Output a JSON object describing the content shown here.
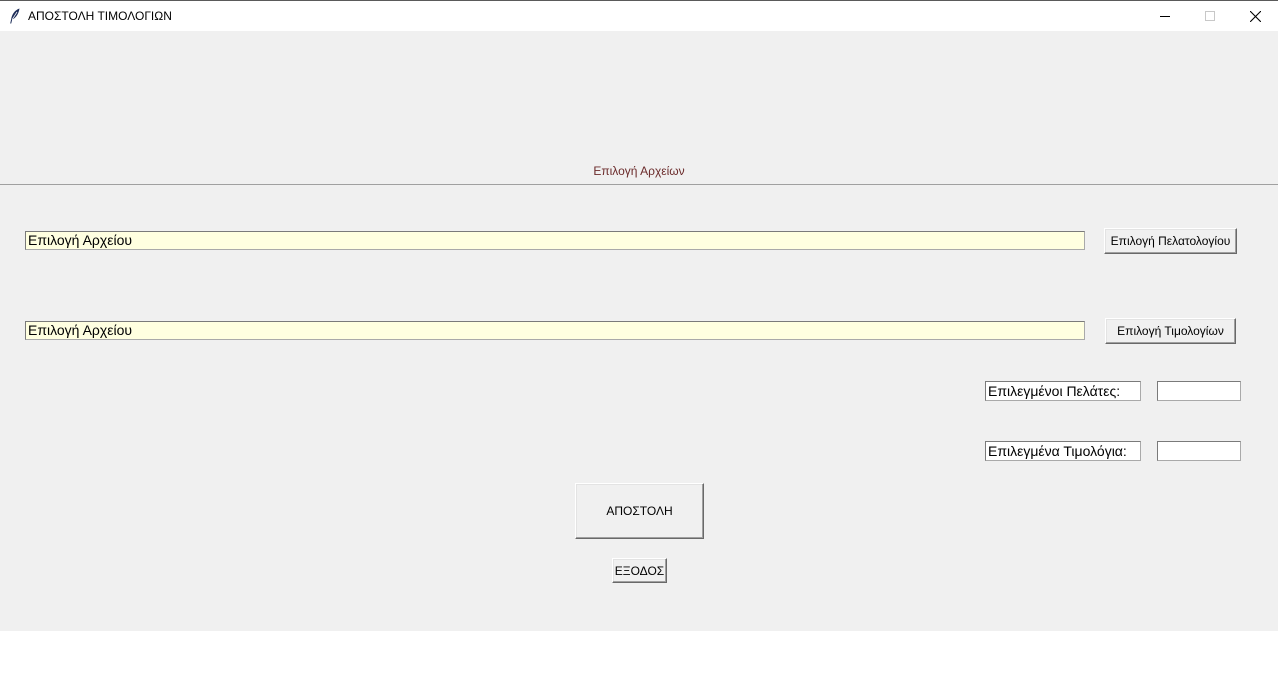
{
  "window": {
    "title": "ΑΠΟΣΤΟΛΗ ΤΙΜΟΛΟΓΙΩΝ",
    "icon": "feather-icon",
    "controls": [
      "minimize-icon",
      "maximize-icon",
      "close-icon"
    ]
  },
  "section": {
    "label": "Επιλογή Αρχείων"
  },
  "customers_file": {
    "value": "Επιλογή Αρχείου",
    "button_label": "Επιλογή Πελατολογίου"
  },
  "invoices_file": {
    "value": "Επιλογή Αρχείου",
    "button_label": "Επιλογή Τιμολογίων"
  },
  "selected_customers": {
    "label": "Επιλεγμένοι Πελάτες:",
    "value": ""
  },
  "selected_invoices": {
    "label": "Επιλεγμένα Τιμολόγια:",
    "value": ""
  },
  "actions": {
    "send_label": "ΑΠΟΣΤΟΛΗ",
    "exit_label": "ΕΞΟΔΟΣ"
  },
  "colors": {
    "client_bg": "#f0f0f0",
    "field_bg": "#ffffe0",
    "section_label": "#6b2b2b"
  }
}
